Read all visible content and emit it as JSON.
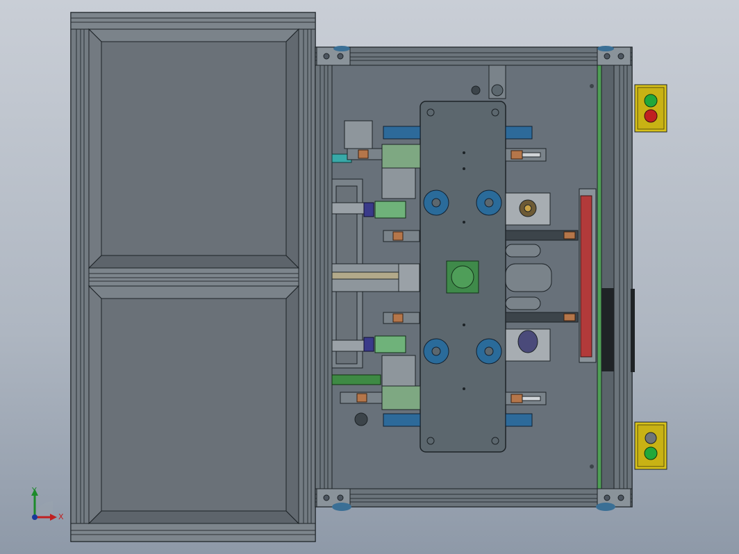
{
  "viewport": {
    "title": "",
    "background": [
      "#c9ced6",
      "#8e99a8"
    ]
  },
  "colors": {
    "frame": "#5d6770",
    "panel": "#6f767d",
    "plate": "#5e6a71",
    "accent_blue": "#2d6a9a",
    "accent_green": "#6fb27a",
    "accent_red": "#b23a3a",
    "button_box": "#d8c21a",
    "button_green": "#22a83a",
    "button_red": "#c02020"
  },
  "triad": {
    "x_label": "X",
    "y_label": "Y"
  },
  "icons": [
    "triad-axis-icon",
    "push-button-icon",
    "bolt-icon",
    "cylinder-icon"
  ]
}
